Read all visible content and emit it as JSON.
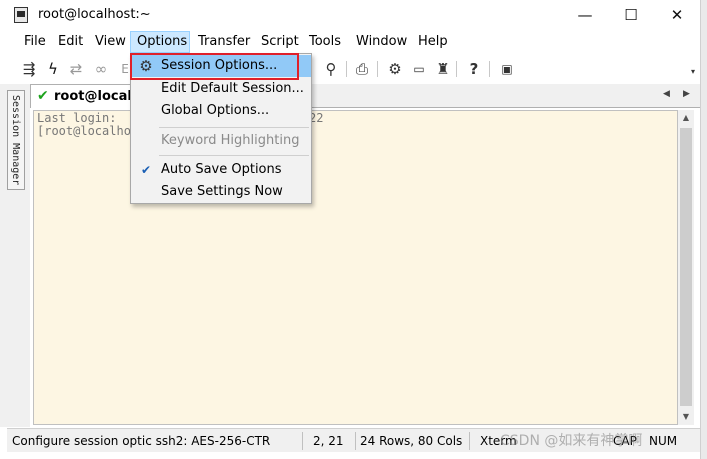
{
  "window": {
    "title": "root@localhost:~",
    "minimize_glyph": "—",
    "maximize_glyph": "☐",
    "close_glyph": "✕"
  },
  "menubar": {
    "items": [
      "File",
      "Edit",
      "View",
      "Options",
      "Transfer",
      "Script",
      "Tools",
      "Window",
      "Help"
    ],
    "active": "Options"
  },
  "toolbar": {
    "icons": [
      "connect-icon",
      "quick-connect-icon",
      "reconnect-icon",
      "disconnect-icon",
      "find-icon",
      "print-icon",
      "settings-icon",
      "keymap-icon",
      "sftp-icon",
      "help-icon",
      "log-icon"
    ]
  },
  "side_panel": {
    "label": "Session Manager"
  },
  "tab": {
    "label": "root@localhost:~",
    "check_glyph": "✔"
  },
  "terminal": {
    "line1_left": "Last login: ",
    "line1_right": "22",
    "line2": "[root@localhost"
  },
  "dropdown": {
    "items": [
      {
        "label": "Session Options...",
        "icon": "gear-icon",
        "enabled": true,
        "highlighted": true
      },
      {
        "label": "Edit Default Session...",
        "enabled": true
      },
      {
        "label": "Global Options...",
        "enabled": true
      },
      {
        "label": "Keyword Highlighting",
        "enabled": false
      },
      {
        "label": "Auto Save Options",
        "checked": true,
        "enabled": true
      },
      {
        "label": "Save Settings Now",
        "enabled": true
      }
    ],
    "highlight_color": "#91c9f7",
    "callout_color": "#e0202a"
  },
  "statusbar": {
    "message": "Configure session optic ssh2: AES-256-CTR",
    "cursor_pos": "2,  21",
    "dimensions": "24 Rows, 80 Cols",
    "terminal_type": "Xterm",
    "caps": "CAP",
    "num": "NUM"
  },
  "watermark": {
    "text": "CSDN @如来有神掌啊"
  },
  "colors": {
    "terminal_bg": "#fdf6e3",
    "menu_active_bg": "#cce8ff"
  }
}
